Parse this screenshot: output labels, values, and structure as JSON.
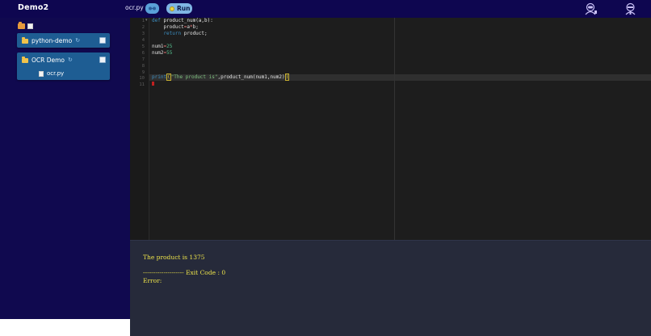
{
  "header": {
    "app_title": "Demo2",
    "filename": "ocr.py",
    "run_label": "Run",
    "icons": [
      "share-icon",
      "run-icon",
      "user-astronaut-icon",
      "user-ninja-icon"
    ]
  },
  "sidebar": {
    "tools": [
      "new-folder-icon",
      "new-file-icon"
    ],
    "projects": [
      {
        "label": "python-demo",
        "files": []
      },
      {
        "label": "OCR Demo",
        "files": [
          {
            "label": "ocr.py"
          }
        ]
      }
    ]
  },
  "editor": {
    "line_numbers": [
      "1",
      "2",
      "3",
      "4",
      "5",
      "6",
      "7",
      "8",
      "9",
      "10",
      "11"
    ],
    "code": {
      "l1_kw": "def",
      "l1_rest": " product_num(a,b):",
      "l2_a": "    product",
      "l2_op": "=",
      "l2_b": "a",
      "l2_op2": "*",
      "l2_c": "b;",
      "l3_kw": "    return",
      "l3_rest": " product;",
      "l5_a": "num1",
      "l5_op": "=",
      "l5_num": "25",
      "l6_a": "num2",
      "l6_op": "=",
      "l6_num": "55",
      "l10_kw": "print",
      "l10_open": "(",
      "l10_str": "\"The product is\"",
      "l10_mid": ",product_num(num1,num2)",
      "l10_close": ")"
    }
  },
  "output": {
    "result": "The product is 1375",
    "exit": "-------------------- Exit Code : 0",
    "error": "Error:"
  },
  "colors": {
    "header_bg": "#0e0650",
    "sidebar_bg": "#10094f",
    "project_bg": "#1e5d93",
    "editor_bg": "#1d1d1d",
    "output_bg": "#262a3a",
    "output_text": "#ece24a"
  }
}
